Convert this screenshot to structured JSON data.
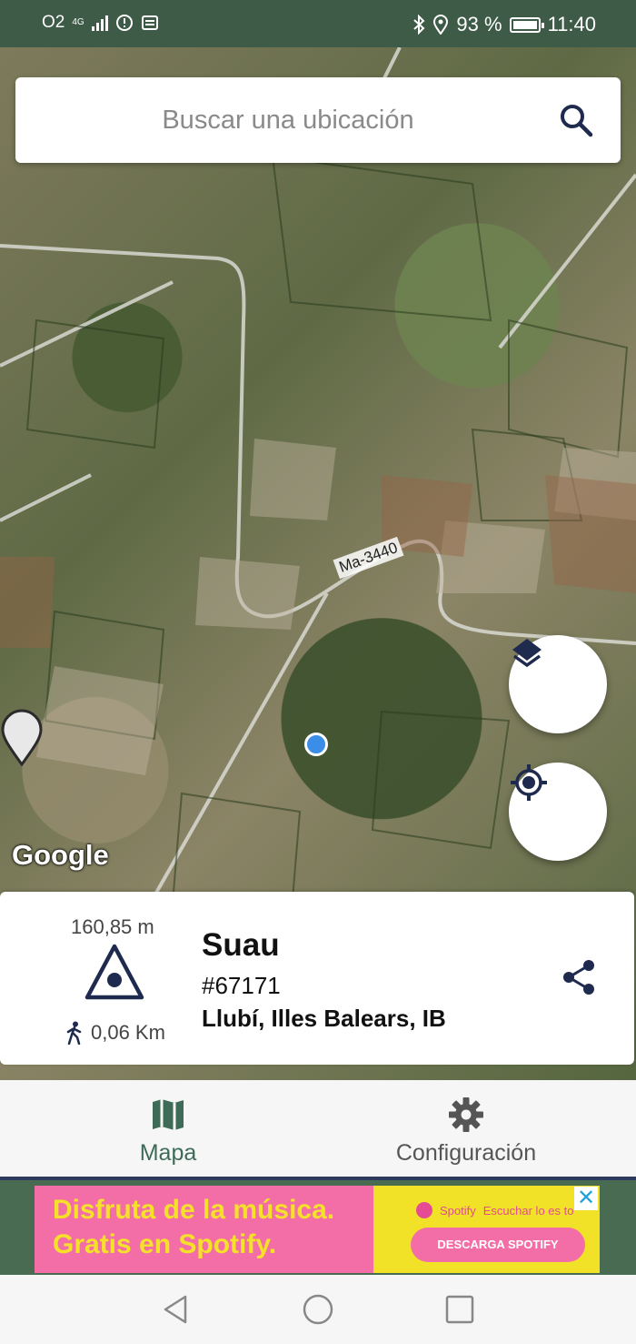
{
  "status_bar": {
    "carrier": "O2",
    "network": "4G",
    "battery": "93 %",
    "time": "11:40"
  },
  "search": {
    "placeholder": "Buscar una ubicación"
  },
  "map": {
    "road_label": "Ma-3440",
    "attribution": "Google"
  },
  "info_card": {
    "elevation": "160,85 m",
    "name": "Suau",
    "id": "#67171",
    "location": "Llubí, Illes Balears, IB",
    "distance": "0,06 Km"
  },
  "bottom_nav": {
    "items": [
      {
        "label": "Mapa",
        "active": true
      },
      {
        "label": "Configuración",
        "active": false
      }
    ]
  },
  "ad": {
    "headline": "Disfruta de la música. Gratis en Spotify.",
    "brand": "Spotify",
    "tagline": "Escuchar lo es to",
    "button": "DESCARGA SPOTIFY",
    "close": "✕"
  },
  "colors": {
    "accent": "#3e6b57",
    "status_bar": "#3e5b47",
    "icon_navy": "#1e2a4e"
  }
}
